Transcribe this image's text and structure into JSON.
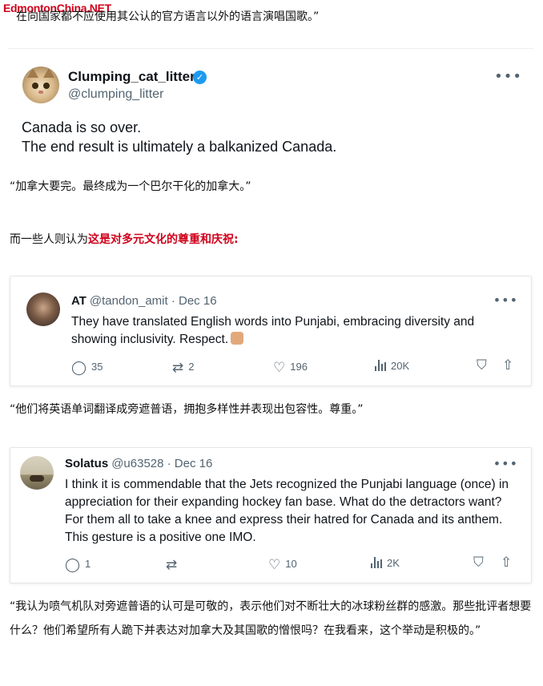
{
  "watermark": "EdmontonChina.NET",
  "intro_quote": "在向国家都不应使用其公认的官方语言以外的语言演唱国歌。”",
  "tweet_main": {
    "name": "Clumping_cat_litter",
    "handle": "@clumping_litter",
    "verified_icon": "verified-check-icon",
    "line1": "Canada is so over.",
    "line2": "The end result is ultimately a balkanized Canada.",
    "more": "•••"
  },
  "translation1": "“加拿大要完。最终成为一个巴尔干化的加拿大。”",
  "transition": {
    "prefix": "而一些人则认为",
    "highlight": "这是对多元文化的尊重和庆祝:",
    "highlight_color": "#d0021b"
  },
  "tweet_at": {
    "name": "AT",
    "handle_date": "@tandon_amit · Dec 16",
    "text": "They have translated English words into Punjabi, embracing diversity and showing inclusivity. Respect.",
    "replies": "35",
    "retweets": "2",
    "likes": "196",
    "views": "20K",
    "more": "•••"
  },
  "translation2": "“他们将英语单词翻译成旁遮普语，拥抱多样性并表现出包容性。尊重。”",
  "tweet_solatus": {
    "name": "Solatus",
    "handle_date": "@u63528 · Dec 16",
    "text": "I think it is commendable that the Jets recognized the Punjabi language (once) in appreciation for their expanding hockey fan base. What do the detractors want? For them all to take a knee and express their hatred for Canada and its anthem. This gesture is a positive one IMO.",
    "replies": "1",
    "retweets": "",
    "likes": "10",
    "views": "2K",
    "more": "•••"
  },
  "translation3": "“我认为喷气机队对旁遮普语的认可是可敬的，表示他们对不断壮大的冰球粉丝群的感激。那些批评者想要什么？他们希望所有人跪下并表达对加拿大及其国歌的憎恨吗？在我看来，这个举动是积极的。”",
  "colors": {
    "twitter_blue": "#1d9bf0",
    "secondary_text": "#536471"
  }
}
